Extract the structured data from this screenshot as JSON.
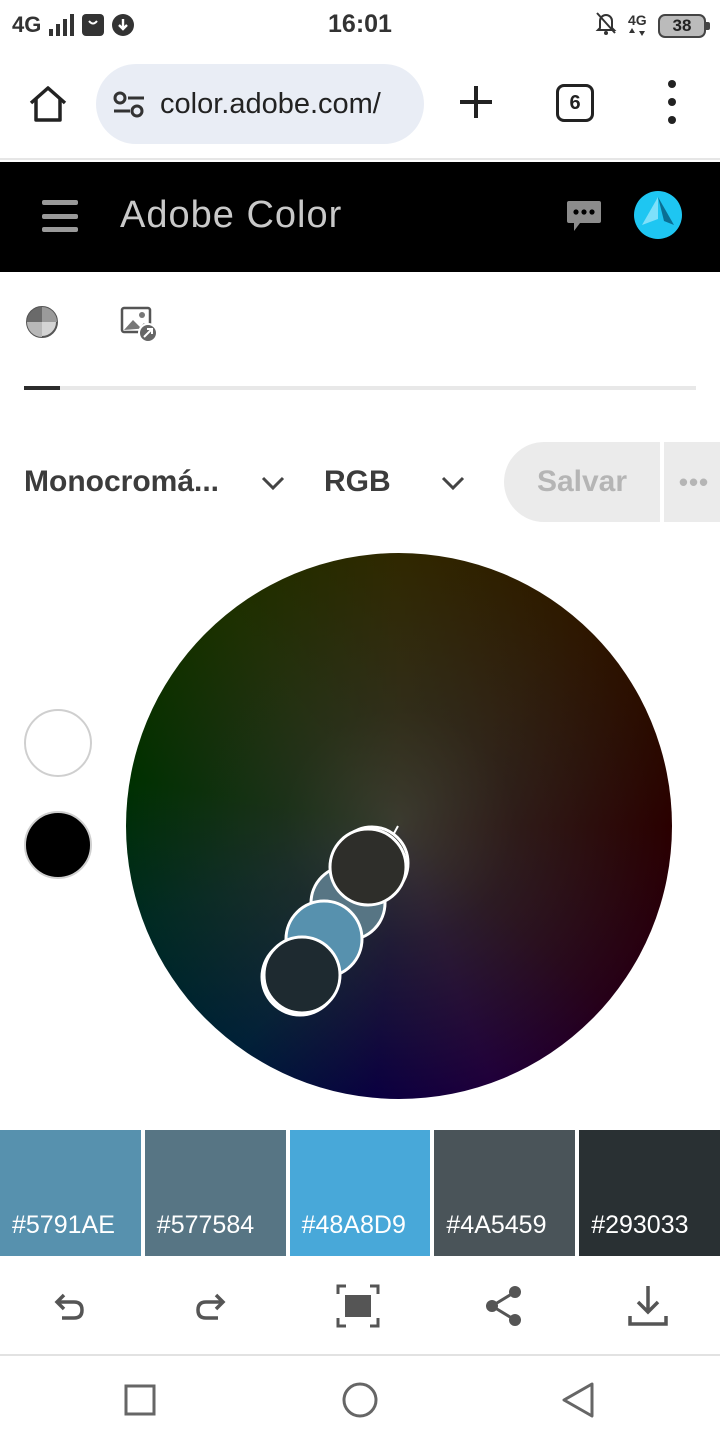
{
  "status_bar": {
    "network": "4G",
    "time": "16:01",
    "net_small": "4G",
    "battery": "38"
  },
  "browser": {
    "url": "color.adobe.com/",
    "tab_count": "6"
  },
  "app": {
    "title": "Adobe Color",
    "avatar_color": "#1ec6f2"
  },
  "controls": {
    "harmony": "Monocromá...",
    "color_mode": "RGB",
    "save_label": "Salvar",
    "more_label": "•••"
  },
  "palette": [
    {
      "hex": "#5791AE"
    },
    {
      "hex": "#577584"
    },
    {
      "hex": "#48A8D9"
    },
    {
      "hex": "#4A5459"
    },
    {
      "hex": "#293033"
    }
  ],
  "actions": [
    "undo-icon",
    "redo-icon",
    "fullscreen-icon",
    "share-icon",
    "download-icon"
  ]
}
